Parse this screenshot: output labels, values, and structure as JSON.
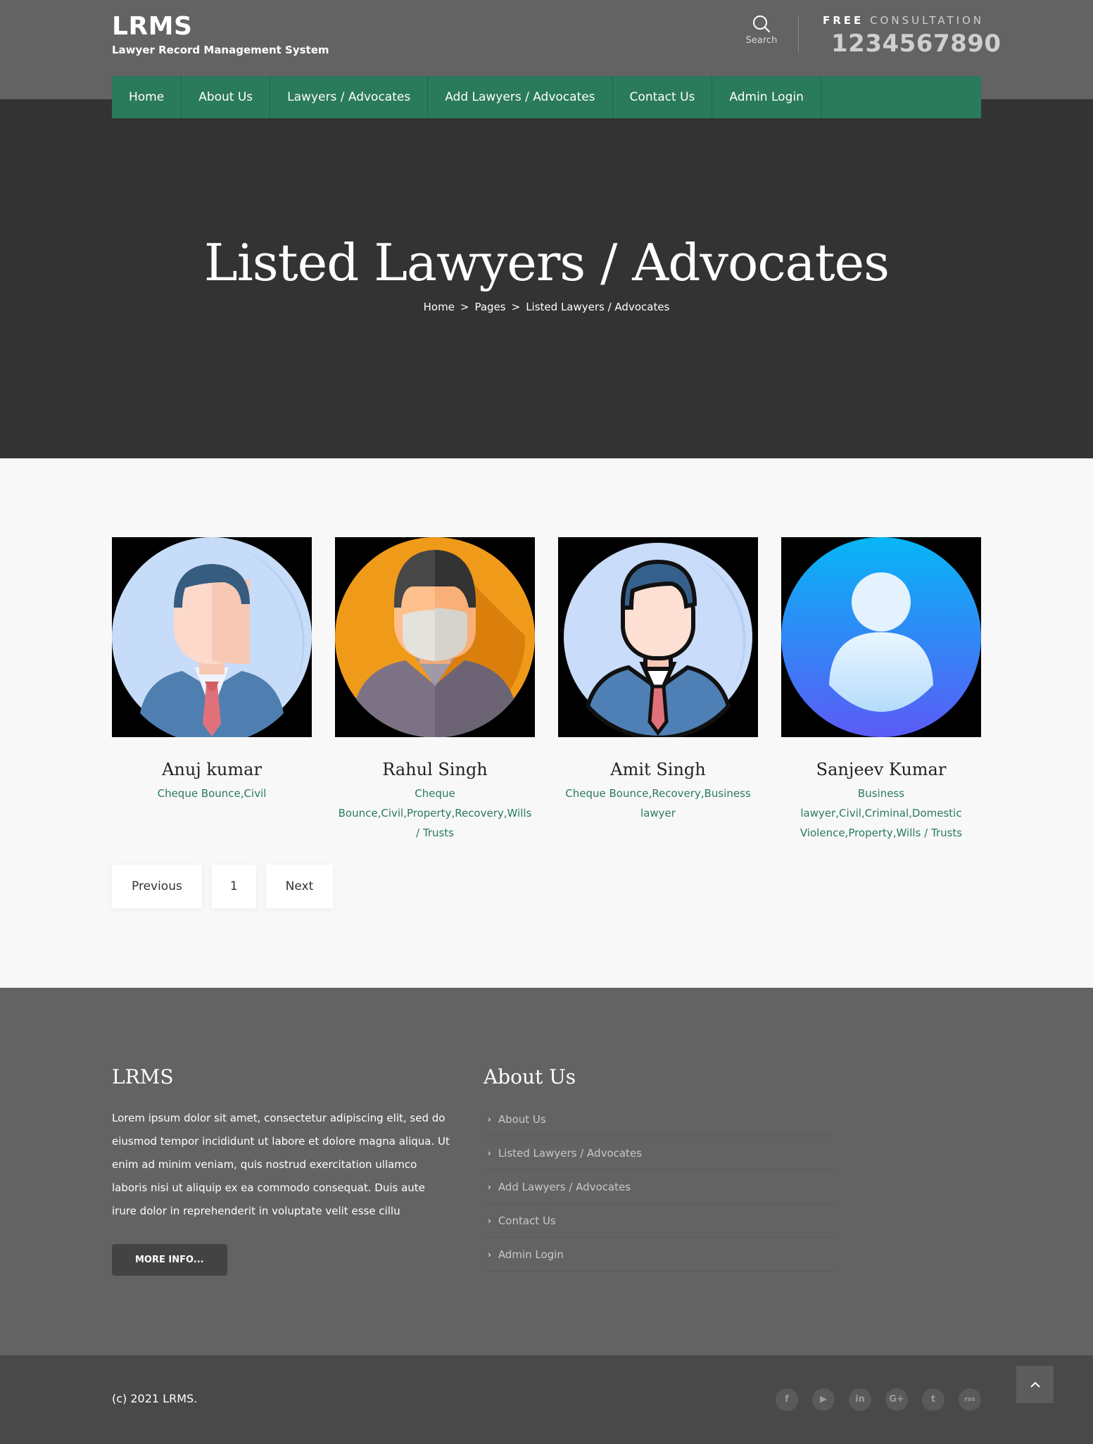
{
  "brand": {
    "title": "LRMS",
    "subtitle": "Lawyer Record Management System"
  },
  "search": {
    "label": "Search",
    "icon": "search-icon"
  },
  "consultation": {
    "free": "FREE",
    "label": "CONSULTATION",
    "phone": "1234567890"
  },
  "nav": [
    "Home",
    "About Us",
    "Lawyers / Advocates",
    "Add Lawyers / Advocates",
    "Contact Us",
    "Admin Login"
  ],
  "hero": {
    "title": "Listed Lawyers / Advocates",
    "breadcrumb": [
      "Home",
      "Pages",
      "Listed Lawyers / Advocates"
    ],
    "separator": ">"
  },
  "lawyers": [
    {
      "name": "Anuj kumar",
      "specialization": "Cheque Bounce,Civil",
      "avatar": "businessman-avatar"
    },
    {
      "name": "Rahul Singh",
      "specialization": "Cheque Bounce,Civil,Property,Recovery,Wills / Trusts",
      "avatar": "masked-man-avatar"
    },
    {
      "name": "Amit Singh",
      "specialization": "Cheque Bounce,Recovery,Business lawyer",
      "avatar": "suited-man-avatar"
    },
    {
      "name": "Sanjeev Kumar",
      "specialization": "Business lawyer,Civil,Criminal,Domestic Violence,Property,Wills / Trusts",
      "avatar": "generic-user-avatar"
    }
  ],
  "pagination": {
    "previous": "Previous",
    "page": "1",
    "next": "Next"
  },
  "footer": {
    "brand_title": "LRMS",
    "about_text": "Lorem ipsum dolor sit amet, consectetur adipiscing elit, sed do eiusmod tempor incididunt ut labore et dolore magna aliqua. Ut enim ad minim veniam, quis nostrud exercitation ullamco laboris nisi ut aliquip ex ea commodo consequat. Duis aute irure dolor in reprehenderit in voluptate velit esse cillu",
    "more_button": "MORE INFO...",
    "links_title": "About Us",
    "links": [
      "About Us",
      "Listed Lawyers / Advocates",
      "Add Lawyers / Advocates",
      "Contact Us",
      "Admin Login"
    ],
    "copyright": "(c) 2021 LRMS.",
    "socials": [
      "f",
      "▶",
      "in",
      "G+",
      "t",
      "rss"
    ],
    "social_icons": [
      "facebook-icon",
      "youtube-icon",
      "linkedin-icon",
      "google-plus-icon",
      "twitter-icon",
      "rss-icon"
    ],
    "back_to_top": "^"
  },
  "colors": {
    "nav": "#2a7a5c",
    "accent": "#2a7a5c",
    "header": "#636363",
    "hero": "#333333",
    "footer": "#636363",
    "bottombar": "#494949"
  }
}
